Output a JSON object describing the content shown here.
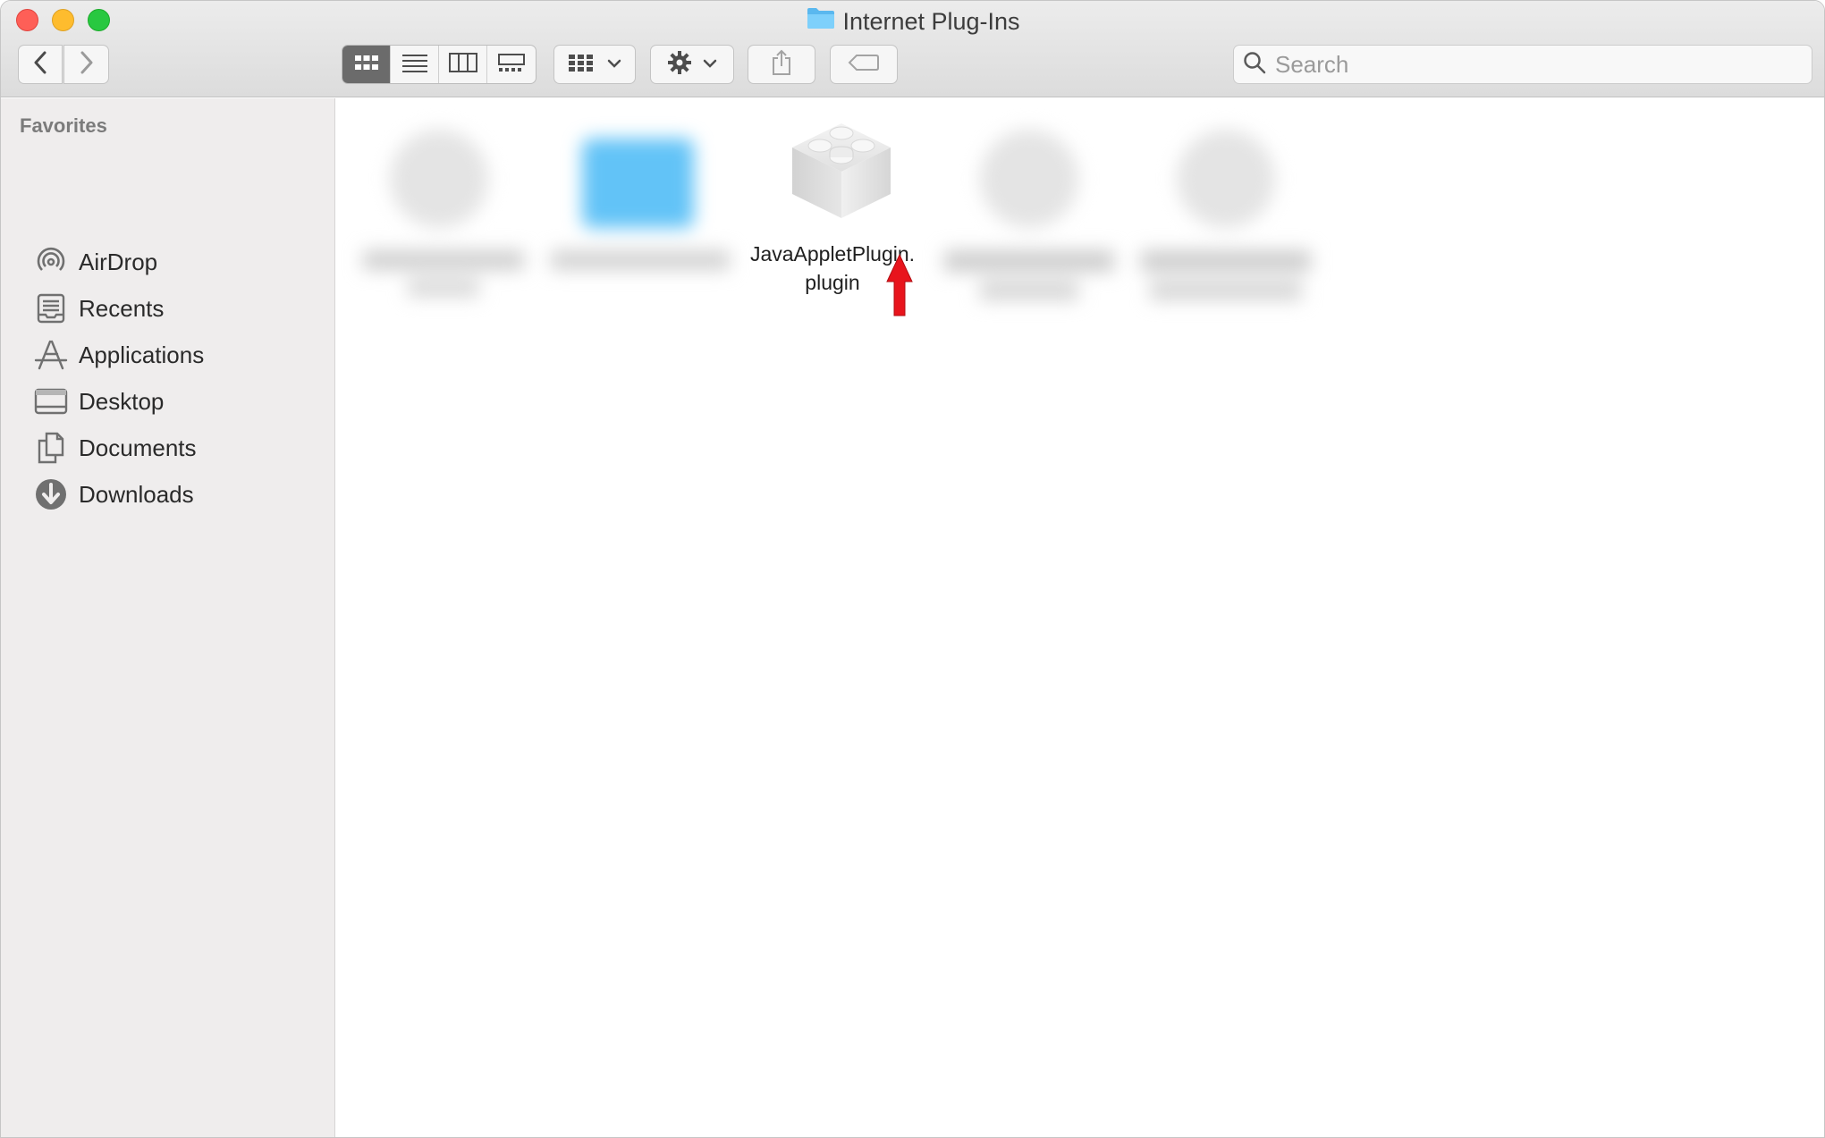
{
  "window": {
    "title": "Internet Plug-Ins",
    "title_icon": "folder-icon"
  },
  "toolbar": {
    "back_icon": "chevron-left-icon",
    "forward_icon": "chevron-right-icon",
    "view_modes": [
      "icon-view",
      "list-view",
      "column-view",
      "gallery-view"
    ],
    "active_view": "icon-view",
    "group_icon": "group-by-icon",
    "action_icon": "gear-icon",
    "share_icon": "share-icon",
    "tag_icon": "tag-icon"
  },
  "search": {
    "placeholder": "Search",
    "value": ""
  },
  "sidebar": {
    "heading": "Favorites",
    "items": [
      {
        "label": "AirDrop",
        "icon": "airdrop-icon"
      },
      {
        "label": "Recents",
        "icon": "recents-icon"
      },
      {
        "label": "Applications",
        "icon": "applications-icon"
      },
      {
        "label": "Desktop",
        "icon": "desktop-icon"
      },
      {
        "label": "Documents",
        "icon": "documents-icon"
      },
      {
        "label": "Downloads",
        "icon": "downloads-icon"
      }
    ]
  },
  "files": [
    {
      "name_line1": "JavaAppletPlugin.",
      "name_line2": "plugin",
      "icon": "plugin-lego-icon",
      "highlighted": true
    }
  ],
  "annotation": {
    "icon": "red-arrow-icon",
    "color": "#e8141c"
  },
  "colors": {
    "close": "#fe5f57",
    "minimize": "#febc2e",
    "maximize": "#28c840",
    "folder_blue": "#62c3f7"
  }
}
